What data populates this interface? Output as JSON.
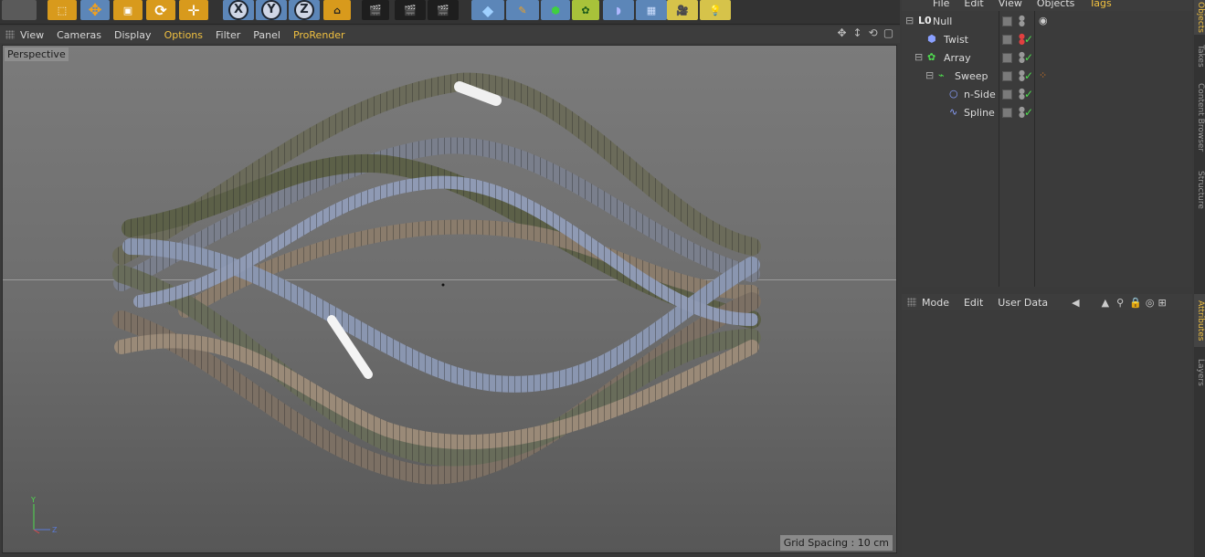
{
  "viewport_menu": {
    "items": [
      "View",
      "Cameras",
      "Display",
      "Options",
      "Filter",
      "Panel",
      "ProRender"
    ],
    "active": "Options",
    "accent": "ProRender"
  },
  "viewport": {
    "label": "Perspective",
    "grid_spacing": "Grid Spacing : 10 cm",
    "axis_y": "Y",
    "axis_z": "Z"
  },
  "toolbar": {
    "axis_x": "X",
    "axis_y": "Y",
    "axis_z": "Z"
  },
  "objects_menu": [
    "File",
    "Edit",
    "View",
    "Objects",
    "Tags"
  ],
  "objects_tree": [
    {
      "name": "Null",
      "icon": "null-icon",
      "indent": 0
    },
    {
      "name": "Twist",
      "icon": "twist-icon",
      "indent": 1
    },
    {
      "name": "Array",
      "icon": "array-icon",
      "indent": 1
    },
    {
      "name": "Sweep",
      "icon": "sweep-icon",
      "indent": 2
    },
    {
      "name": "n-Side",
      "icon": "nside-icon",
      "indent": 3
    },
    {
      "name": "Spline",
      "icon": "spline-icon",
      "indent": 3
    }
  ],
  "attributes_menu": [
    "Mode",
    "Edit",
    "User Data"
  ],
  "side_tabs": [
    "Objects",
    "Takes",
    "Content Browser",
    "Structure",
    "Attributes",
    "Layers"
  ],
  "colors": {
    "accent_yellow": "#f0c040",
    "check_green": "#4fdc4f"
  }
}
